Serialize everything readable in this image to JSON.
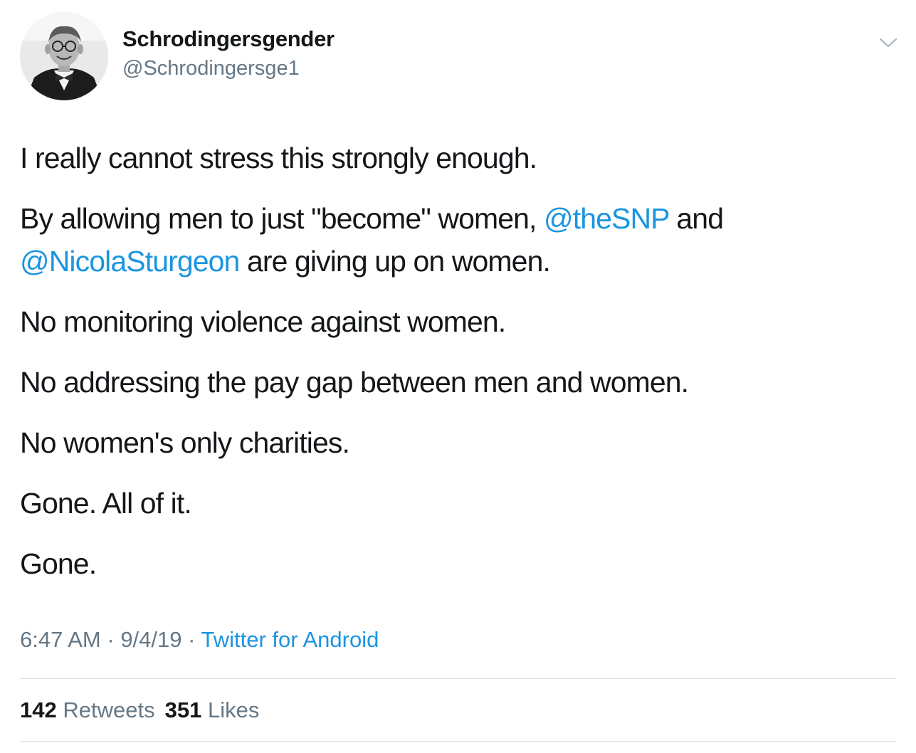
{
  "tweet": {
    "author": {
      "display_name": "Schrodingersgender",
      "handle": "@Schrodingersge1"
    },
    "menu_icon": "chevron-down-icon",
    "paragraphs": {
      "p1": "I really cannot stress this strongly enough.",
      "p2_a": "By allowing men to just \"become\" women, ",
      "p2_mention1": "@theSNP",
      "p2_b": " and ",
      "p2_mention2": "@NicolaSturgeon",
      "p2_c": " are giving up on women.",
      "p3": "No monitoring violence against women.",
      "p4": "No addressing the pay gap between men and women.",
      "p5": "No women's only charities.",
      "p6": "Gone. All of it.",
      "p7": "Gone."
    },
    "meta": {
      "time": "6:47 AM",
      "separator": " · ",
      "date": "9/4/19",
      "source": "Twitter for Android"
    },
    "stats": {
      "retweets_count": "142",
      "retweets_label": "Retweets",
      "likes_count": "351",
      "likes_label": "Likes"
    },
    "colors": {
      "link": "#1b95e0",
      "secondary_text": "#657786",
      "primary_text": "#14171a",
      "divider": "#d7dee3"
    }
  }
}
